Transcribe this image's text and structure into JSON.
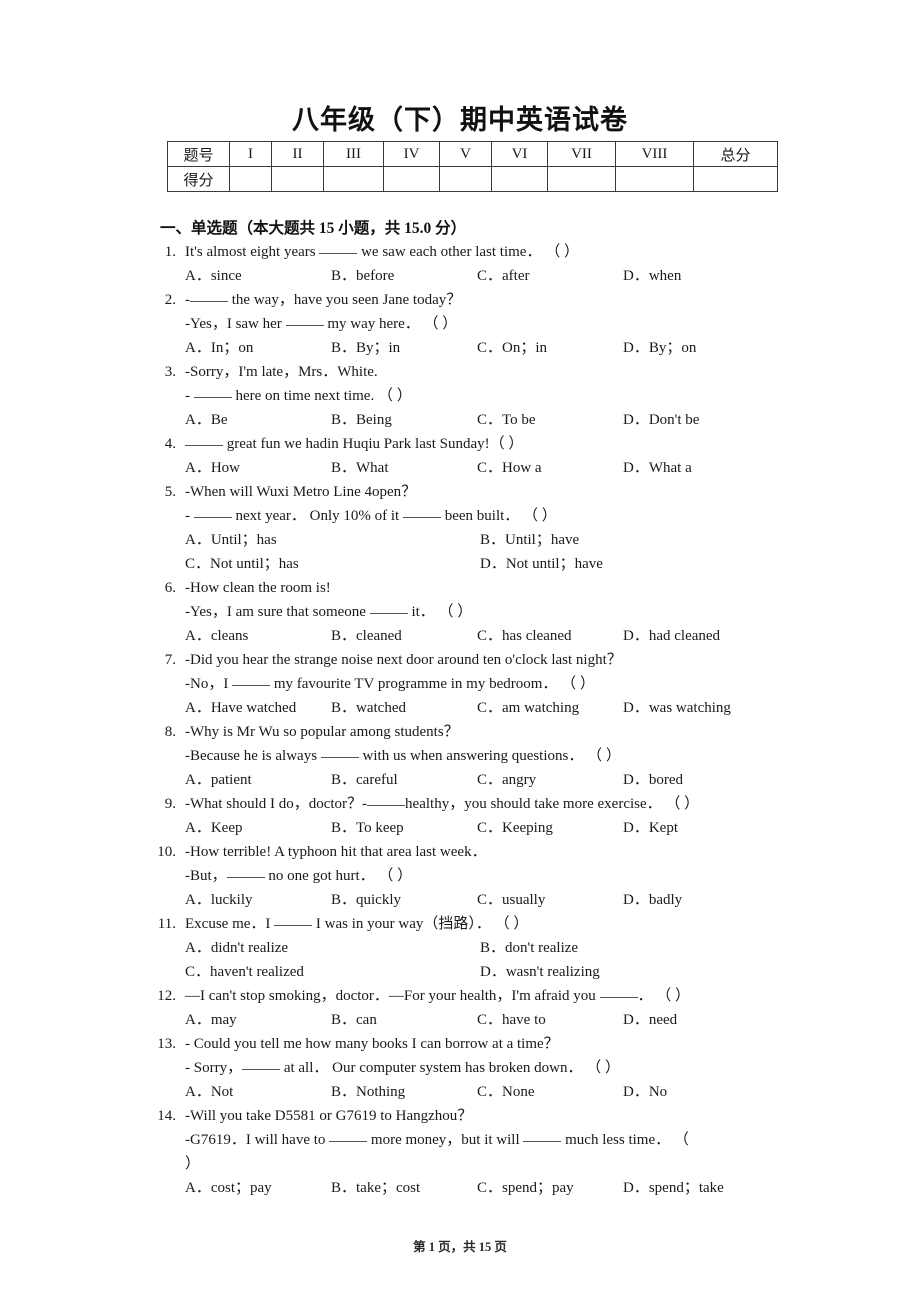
{
  "document": {
    "title": "八年级（下）期中英语试卷",
    "footer": "第 1 页，共 15 页"
  },
  "score_table": {
    "row_labels": [
      "题号",
      "得分"
    ],
    "columns": [
      "I",
      "II",
      "III",
      "IV",
      "V",
      "VI",
      "VII",
      "VIII",
      "总分"
    ],
    "scores": [
      "",
      "",
      "",
      "",
      "",
      "",
      "",
      "",
      ""
    ]
  },
  "section": {
    "heading": "一、单选题（本大题共 15 小题，共 15.0 分）"
  },
  "questions": [
    {
      "num": "1.",
      "lines": [
        "It's almost eight years ____ we saw each other last time． （     ）"
      ],
      "layout": "4",
      "options": [
        "A．since",
        "B．before",
        "C．after",
        "D．when"
      ]
    },
    {
      "num": "2.",
      "lines": [
        "-____ the way，have you seen Jane today？",
        "-Yes，I saw her ____ my way here． （     ）"
      ],
      "layout": "4",
      "options": [
        "A．In；on",
        "B．By；in",
        "C．On；in",
        "D．By；on"
      ]
    },
    {
      "num": "3.",
      "lines": [
        "-Sorry，I'm late，Mrs．White.",
        "- ____ here on time next time. （     ）"
      ],
      "layout": "4",
      "options": [
        "A．Be",
        "B．Being",
        "C．To be",
        "D．Don't be"
      ]
    },
    {
      "num": "4.",
      "lines": [
        "____ great fun we hadin Huqiu Park last Sunday!（     ）"
      ],
      "layout": "4",
      "options": [
        "A．How",
        "B．What",
        "C．How a",
        "D．What a"
      ]
    },
    {
      "num": "5.",
      "lines": [
        "-When will Wuxi Metro Line 4open？",
        "- ____ next year． Only 10% of it ____ been built． （     ）"
      ],
      "layout": "2",
      "options": [
        "A．Until；has",
        "B．Until；have",
        "C．Not until；has",
        "D．Not until；have"
      ]
    },
    {
      "num": "6.",
      "lines": [
        "-How clean the room is!",
        "-Yes，I am sure that someone ____ it． （     ）"
      ],
      "layout": "4",
      "options": [
        "A．cleans",
        "B．cleaned",
        "C．has cleaned",
        "D．had cleaned"
      ]
    },
    {
      "num": "7.",
      "lines": [
        "-Did you hear the strange noise next door around ten o'clock last night？",
        "-No，I ____ my favourite TV programme in my bedroom． （     ）"
      ],
      "layout": "4",
      "options": [
        "A．Have watched",
        "B．watched",
        "C．am watching",
        "D．was watching"
      ]
    },
    {
      "num": "8.",
      "lines": [
        "-Why is Mr Wu so popular among students？",
        "-Because he is always ____ with us when answering questions． （     ）"
      ],
      "layout": "4",
      "options": [
        "A．patient",
        "B．careful",
        "C．angry",
        "D．bored"
      ]
    },
    {
      "num": "9.",
      "lines": [
        "-What should I do，doctor？-____healthy，you should take more exercise． （     ）"
      ],
      "layout": "4",
      "options": [
        "A．Keep",
        "B．To keep",
        "C．Keeping",
        "D．Kept"
      ]
    },
    {
      "num": "10.",
      "lines": [
        "-How terrible! A typhoon hit that area last week．",
        "-But，____ no one got hurt． （     ）"
      ],
      "layout": "4",
      "options": [
        "A．luckily",
        "B．quickly",
        "C．usually",
        "D．badly"
      ]
    },
    {
      "num": "11.",
      "lines": [
        "Excuse me．I ____ I was in your way（挡路）． （     ）"
      ],
      "layout": "2",
      "options": [
        "A．didn't realize",
        "B．don't realize",
        "C．haven't realized",
        "D．wasn't realizing"
      ]
    },
    {
      "num": "12.",
      "lines": [
        "—I can't stop smoking，doctor．—For your health，I'm afraid you ____． （     ）"
      ],
      "layout": "4",
      "options": [
        "A．may",
        "B．can",
        "C．have to",
        "D．need"
      ]
    },
    {
      "num": "13.",
      "lines": [
        "- Could you tell me how many books I can borrow at a time？",
        "- Sorry，____ at all． Our computer system has broken down． （     ）"
      ],
      "layout": "4",
      "options": [
        "A．Not",
        "B．Nothing",
        "C．None",
        "D．No"
      ]
    },
    {
      "num": "14.",
      "lines": [
        "-Will you take D5581 or G7619 to Hangzhou？",
        "-G7619．I will have to ____ more money，but it will ____ much less time． （",
        "）"
      ],
      "layout": "4",
      "options": [
        "A．cost；pay",
        "B．take；cost",
        "C．spend；pay",
        "D．spend；take"
      ]
    }
  ]
}
